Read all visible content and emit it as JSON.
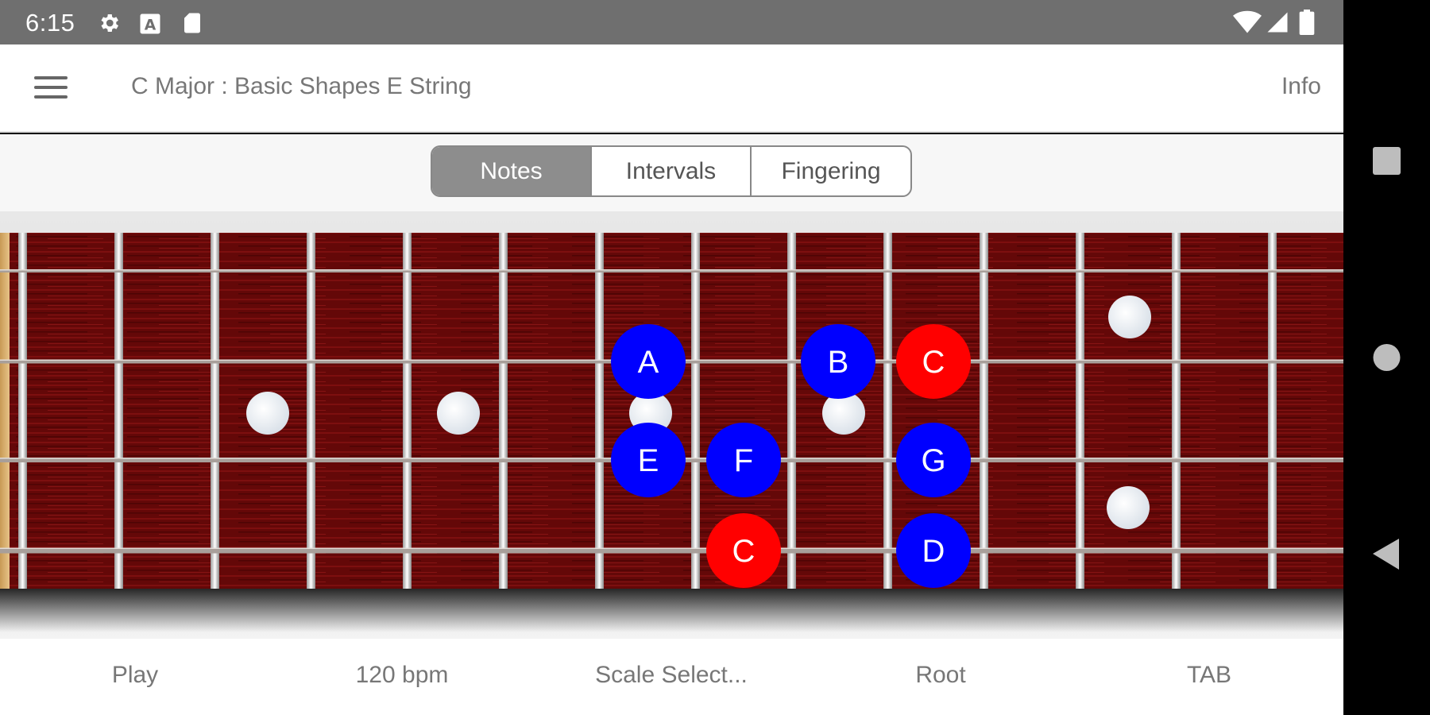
{
  "status_bar": {
    "time": "6:15",
    "icons": [
      "settings-icon",
      "text-a-icon",
      "sd-card-icon",
      "wifi-icon",
      "signal-icon",
      "battery-icon"
    ]
  },
  "app_bar": {
    "menu_icon": "hamburger-menu-icon",
    "title": "C Major : Basic Shapes E String",
    "info_label": "Info"
  },
  "segments": {
    "selected": "Notes",
    "items": [
      {
        "label": "Notes"
      },
      {
        "label": "Intervals"
      },
      {
        "label": "Fingering"
      }
    ]
  },
  "fretboard": {
    "colors": {
      "wood": "#6a0a0a",
      "root_note": "#ff0000",
      "scale_note": "#0000ff",
      "note_text": "#ffffff",
      "inlay": "#e9eef4"
    },
    "notes": [
      {
        "label": "A",
        "type": "scale"
      },
      {
        "label": "B",
        "type": "scale"
      },
      {
        "label": "C",
        "type": "root"
      },
      {
        "label": "E",
        "type": "scale"
      },
      {
        "label": "F",
        "type": "scale"
      },
      {
        "label": "G",
        "type": "scale"
      },
      {
        "label": "C",
        "type": "root"
      },
      {
        "label": "D",
        "type": "scale"
      }
    ]
  },
  "bottom_bar": {
    "play": "Play",
    "tempo": "120 bpm",
    "scale_select": "Scale Select...",
    "root": "Root",
    "tab": "TAB"
  },
  "nav_bar": {
    "icons": [
      "recents-square-icon",
      "home-circle-icon",
      "back-triangle-icon"
    ]
  }
}
